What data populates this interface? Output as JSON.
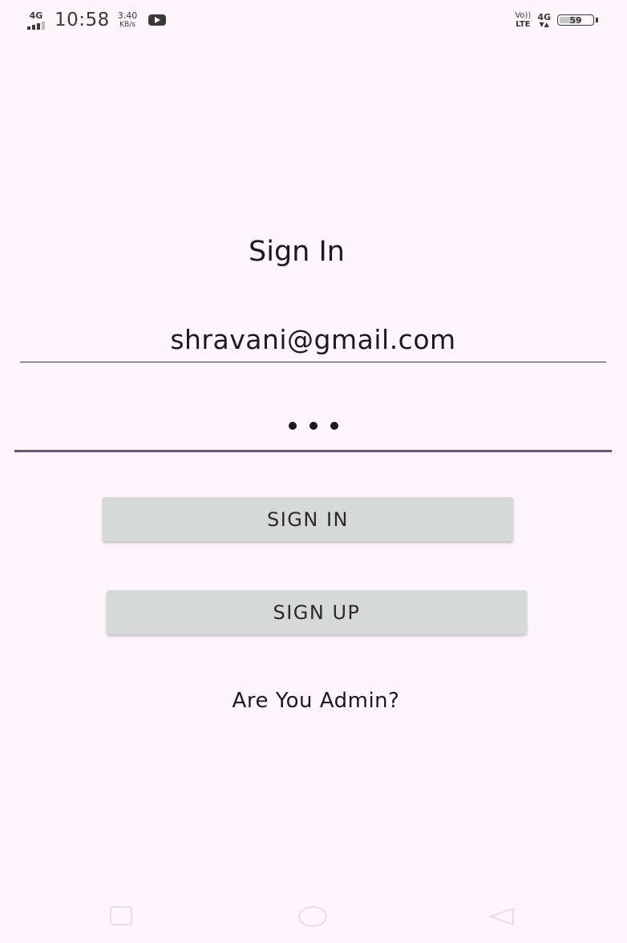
{
  "status_bar": {
    "network_type": "4G",
    "time": "10:58",
    "speed_value": "3.40",
    "speed_unit": "KB/s",
    "notification_icon": "youtube-icon",
    "volte_top": "Vo))",
    "volte_bottom": "LTE",
    "data_network": "4G",
    "data_arrows": "▼▲",
    "battery_level": "59"
  },
  "signin": {
    "title": "Sign In",
    "email_value": "shravani@gmail.com",
    "password_mask": "•••",
    "sign_in_label": "SIGN IN",
    "sign_up_label": "SIGN UP",
    "admin_link": "Are You Admin?"
  },
  "colors": {
    "background": "#fdf7fc",
    "button": "#d7d8d8",
    "active_underline": "#625b71",
    "text": "#1b1b1f"
  },
  "nav_bar": {
    "recent_icon": "recent-apps-icon",
    "home_icon": "home-icon",
    "back_icon": "back-icon"
  }
}
